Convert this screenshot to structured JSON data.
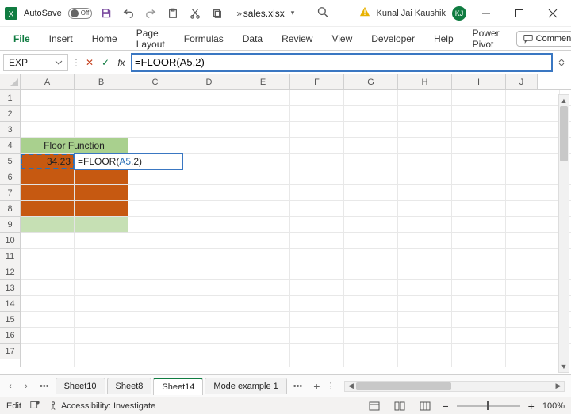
{
  "titlebar": {
    "autosave_label": "AutoSave",
    "autosave_state": "Off",
    "filename": "sales.xlsx",
    "drop_hint": "▾",
    "username": "Kunal Jai Kaushik",
    "avatar_initials": "KJ"
  },
  "qat_overflow": "»",
  "ribbon": {
    "tabs": [
      "File",
      "Insert",
      "Home",
      "Page Layout",
      "Formulas",
      "Data",
      "Review",
      "View",
      "Developer",
      "Help",
      "Power Pivot"
    ],
    "comments_label": "Comments"
  },
  "formula_bar": {
    "name_box": "EXP",
    "fx_label": "fx",
    "formula": "=FLOOR(A5,2)"
  },
  "columns": [
    "A",
    "B",
    "C",
    "D",
    "E",
    "F",
    "G",
    "H",
    "I",
    "J"
  ],
  "rows": [
    "1",
    "2",
    "3",
    "4",
    "5",
    "6",
    "7",
    "8",
    "9",
    "10",
    "11",
    "12",
    "13",
    "14",
    "15",
    "16",
    "17"
  ],
  "sheet": {
    "a4b4_merged": "Floor Function",
    "a5": "34.23",
    "b5_editing_prefix": "=FLOOR(",
    "b5_editing_ref": "A5",
    "b5_editing_suffix": ",2)"
  },
  "tabs": {
    "nav_prev": "‹",
    "nav_next": "›",
    "more": "•••",
    "sheets": [
      "Sheet10",
      "Sheet8",
      "Sheet14",
      "Mode example 1"
    ],
    "active_index": 2,
    "trailing_more": "•••",
    "add": "+",
    "grip": "⋮"
  },
  "statusbar": {
    "mode": "Edit",
    "accessibility": "Accessibility: Investigate",
    "zoom_minus": "−",
    "zoom_plus": "+",
    "zoom_pct": "100%"
  },
  "colors": {
    "brand": "#107c41",
    "header_fill": "#a9d08e",
    "data_fill": "#c65911",
    "empty_fill": "#c6e0b4",
    "ref_blue": "#2a6fb5"
  }
}
